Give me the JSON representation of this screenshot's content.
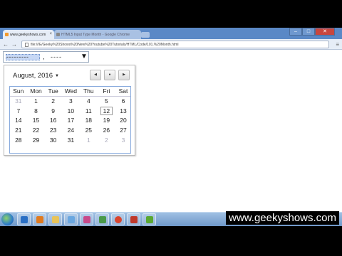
{
  "browser": {
    "tabs": [
      {
        "label": "www.geekyshows.com",
        "active": true
      },
      {
        "label": "HTML5 Input Type Month - Google Chrome",
        "active": false
      }
    ],
    "window_controls": {
      "minimize": "–",
      "maximize": "□",
      "close": "✕"
    },
    "url": "file:///E/Geeky%20Shows%20New%20Youtube%20Tutorials/HTML/Code/101.%20Month.html"
  },
  "month_input": {
    "month_segment": "---------",
    "separator": ",",
    "year_segment": "----",
    "picker_arrow": "▼"
  },
  "calendar": {
    "month_label": "August, 2016",
    "dropdown_icon": "▼",
    "nav": {
      "prev": "◀",
      "today": "●",
      "next": "▶"
    },
    "weekdays": [
      "Sun",
      "Mon",
      "Tue",
      "Wed",
      "Thu",
      "Fri",
      "Sat"
    ],
    "weeks": [
      [
        "31",
        "1",
        "2",
        "3",
        "4",
        "5",
        "6"
      ],
      [
        "7",
        "8",
        "9",
        "10",
        "11",
        "12",
        "13"
      ],
      [
        "14",
        "15",
        "16",
        "17",
        "18",
        "19",
        "20"
      ],
      [
        "21",
        "22",
        "23",
        "24",
        "25",
        "26",
        "27"
      ],
      [
        "28",
        "29",
        "30",
        "31",
        "1",
        "2",
        "3"
      ]
    ],
    "today": "12"
  },
  "watermark": "www.geekyshows.com",
  "colors": {
    "tabstrip": "#5a88c6",
    "selection": "#c7d8f5",
    "grid_border": "#88aadd",
    "taskbar": "#6f98c9"
  },
  "taskbar_icons": [
    "explorer-icon",
    "media-player-icon",
    "folder-icon",
    "notepad-icon",
    "paint-icon",
    "network-icon",
    "chrome-icon",
    "pdf-icon",
    "camtasia-icon"
  ]
}
